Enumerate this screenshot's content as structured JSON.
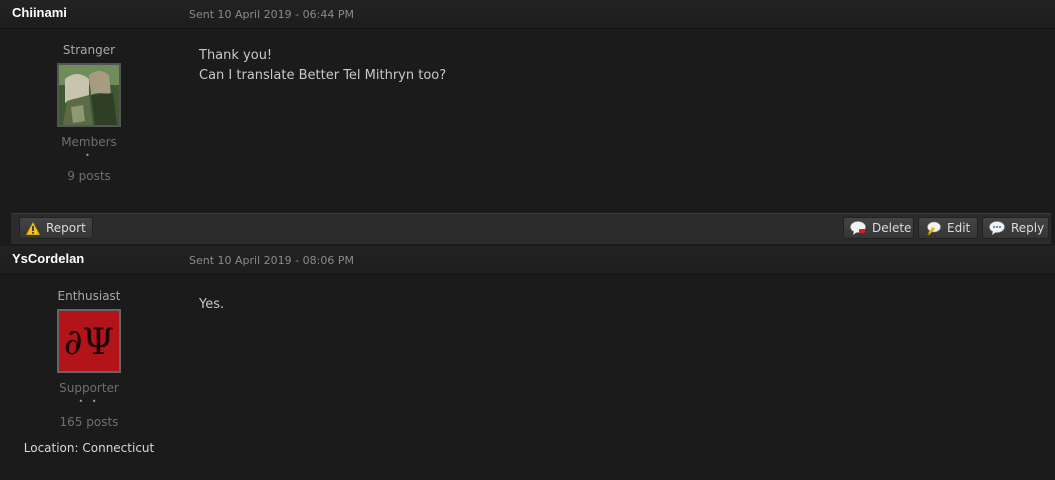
{
  "posts": [
    {
      "author": "Chiinami",
      "date": "Sent 10 April 2019 - 06:44 PM",
      "rank": "Stranger",
      "avatar_icon": "elf-portrait-avatar",
      "group": "Members",
      "pips": "•",
      "post_count": "9 posts",
      "body_lines": [
        "Thank you!",
        "Can I translate Better Tel Mithryn too?"
      ]
    },
    {
      "author": "YsCordelan",
      "date": "Sent 10 April 2019 - 08:06 PM",
      "rank": "Enthusiast",
      "avatar_icon": "greek-letters-avatar",
      "avatar_text": "∂Ψ",
      "group": "Supporter",
      "pips": "• •",
      "post_count": "165 posts",
      "location": "Location: Connecticut",
      "body_lines": [
        "Yes."
      ]
    }
  ],
  "actions": {
    "report": "Report",
    "delete": "Delete",
    "edit": "Edit",
    "reply": "Reply"
  },
  "colors": {
    "background": "#1b1b1b",
    "author": "#ffffff",
    "avatar_red": "#b3141a"
  }
}
